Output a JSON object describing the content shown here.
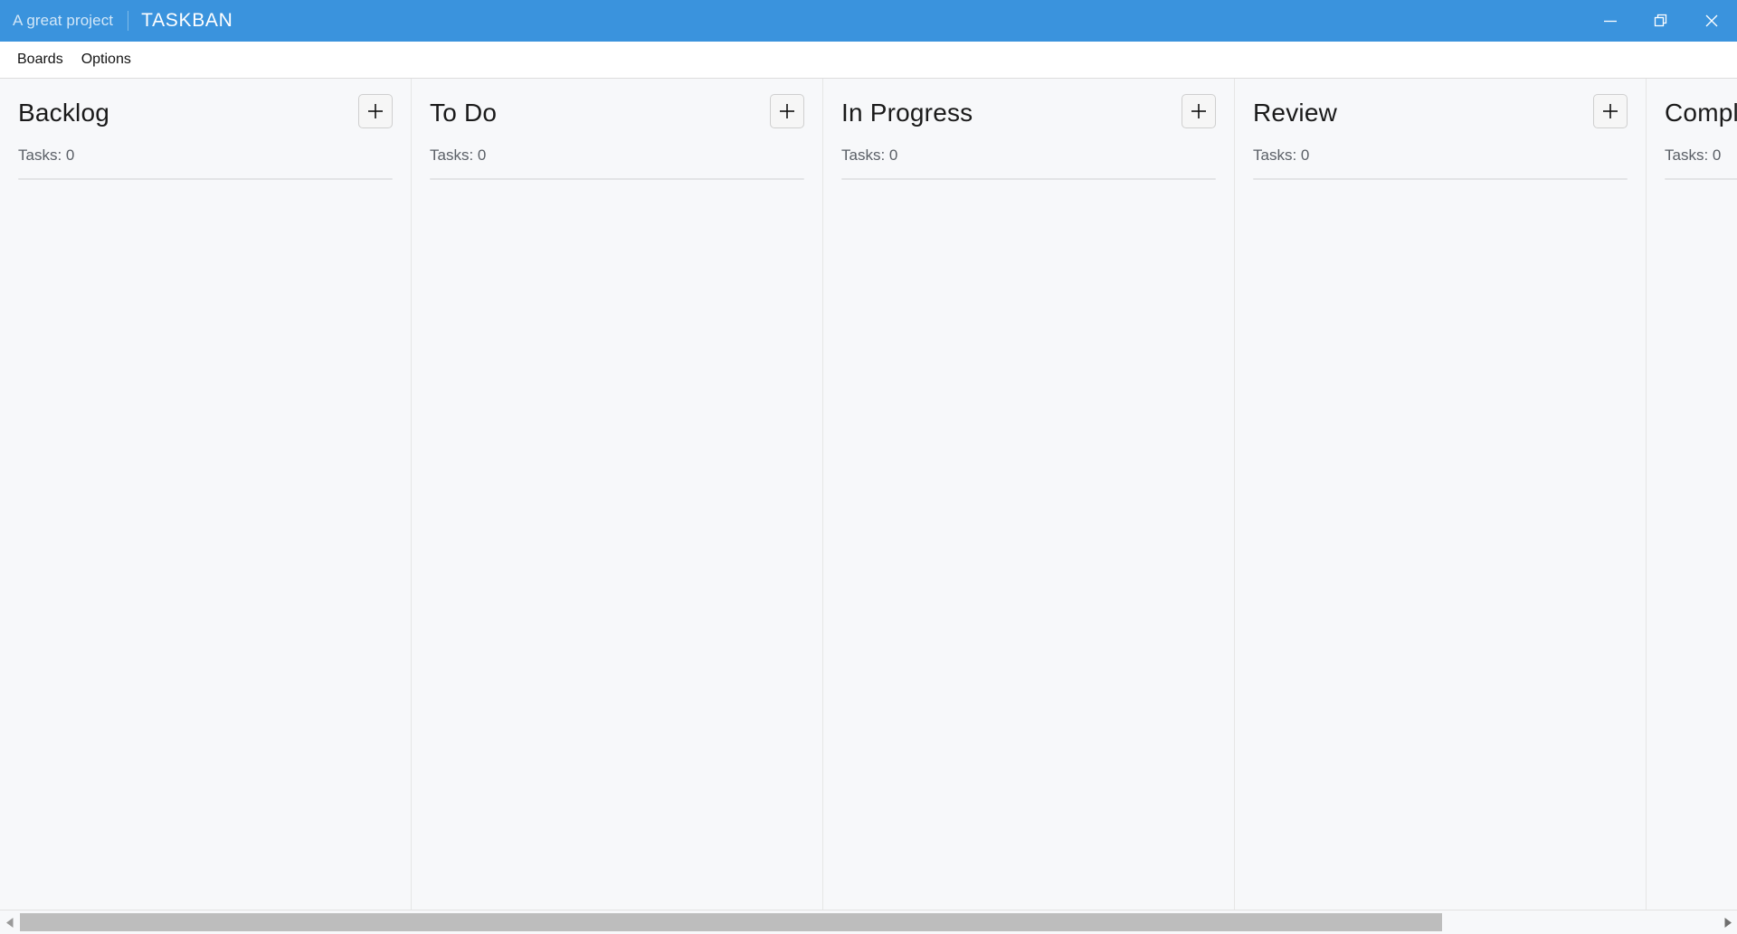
{
  "titlebar": {
    "project_name": "A great project",
    "app_title": "TASKBAN",
    "accent_color": "#3a93dd",
    "controls": [
      {
        "name": "minimize-button",
        "icon": "minimize-icon",
        "label": "Minimize"
      },
      {
        "name": "restore-button",
        "icon": "restore-icon",
        "label": "Restore"
      },
      {
        "name": "close-button",
        "icon": "close-icon",
        "label": "Close"
      }
    ]
  },
  "menubar": {
    "items": [
      {
        "label": "Boards"
      },
      {
        "label": "Options"
      }
    ]
  },
  "board": {
    "background_color": "#f7f8fa",
    "add_button_icon": "plus-icon",
    "columns": [
      {
        "title": "Backlog",
        "count_label": "Tasks: 0",
        "tasks": []
      },
      {
        "title": "To Do",
        "count_label": "Tasks: 0",
        "tasks": []
      },
      {
        "title": "In Progress",
        "count_label": "Tasks: 0",
        "tasks": []
      },
      {
        "title": "Review",
        "count_label": "Tasks: 0",
        "tasks": []
      },
      {
        "title": "Completed",
        "count_label": "Tasks: 0",
        "tasks": []
      }
    ]
  },
  "scrollbar": {
    "left_arrow_icon": "triangle-left-icon",
    "right_arrow_icon": "triangle-right-icon",
    "thumb_color": "#bdbdbd"
  }
}
